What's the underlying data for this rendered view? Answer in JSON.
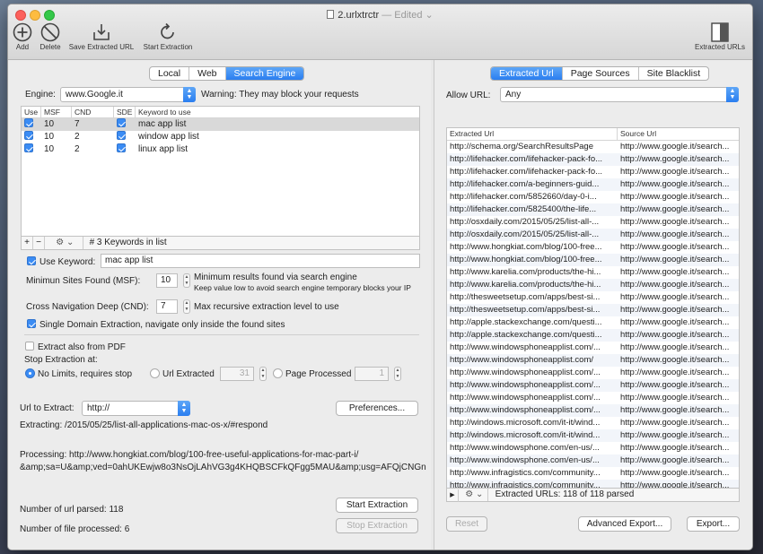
{
  "window": {
    "title": "2.urlxtrctr",
    "edited": "— Edited"
  },
  "toolbar": {
    "add": "Add",
    "delete": "Delete",
    "save": "Save Extracted URL",
    "start": "Start Extraction",
    "extracted_urls": "Extracted URLs"
  },
  "left": {
    "tabs": [
      "Local",
      "Web",
      "Search Engine"
    ],
    "active_tab": "Search Engine",
    "engine_label": "Engine:",
    "engine_value": "www.Google.it",
    "engine_warning": "Warning: They may block your requests",
    "keyword_table": {
      "headers": [
        "Use",
        "MSF",
        "CND",
        "SDE",
        "Keyword to use"
      ],
      "rows": [
        {
          "msf": "10",
          "cnd": "7",
          "keyword": "mac app list"
        },
        {
          "msf": "10",
          "cnd": "2",
          "keyword": "window app list"
        },
        {
          "msf": "10",
          "cnd": "2",
          "keyword": "linux app list"
        }
      ],
      "footer": "# 3 Keywords in list"
    },
    "use_keyword_label": "Use Keyword:",
    "use_keyword_value": "mac app list",
    "msf_label": "Minimun Sites Found (MSF):",
    "msf_value": "10",
    "msf_help": "Minimum results found via search engine",
    "msf_help2": "Keep value low to avoid search engine temporary blocks your IP",
    "cnd_label": "Cross Navigation Deep (CND):",
    "cnd_value": "7",
    "cnd_help": "Max recursive extraction level to use",
    "sde_label": "Single Domain Extraction, navigate only inside the found sites",
    "extract_pdf": "Extract also from PDF",
    "stop_label": "Stop Extraction at:",
    "stop_opt1": "No Limits, requires stop",
    "stop_opt2": "Url Extracted",
    "stop_opt2_value": "31",
    "stop_opt3": "Page Processed",
    "stop_opt3_value": "1",
    "url_label": "Url to Extract:",
    "url_value": "http://",
    "preferences": "Preferences...",
    "extracting": "Extracting: /2015/05/25/list-all-applications-mac-os-x/#respond",
    "processing1": "Processing: http://www.hongkiat.com/blog/100-free-useful-applications-for-mac-part-i/",
    "processing2": "&amp;sa=U&amp;ved=0ahUKEwjw8o3NsOjLAhVG3g4KHQBSCFkQFgg5MAU&amp;usg=AFQjCNGn",
    "parsed_label": "Number of url parsed: 118",
    "processed_label": "Number of file processed: 6",
    "start_btn": "Start Extraction",
    "stop_btn": "Stop Extraction"
  },
  "right": {
    "tabs": [
      "Extracted Url",
      "Page Sources",
      "Site Blacklist"
    ],
    "active_tab": "Extracted Url",
    "allow_label": "Allow URL:",
    "allow_value": "Any",
    "headers": [
      "Extracted Url",
      "Source Url"
    ],
    "rows": [
      [
        "http://schema.org/SearchResultsPage",
        "http://www.google.it/search..."
      ],
      [
        "http://lifehacker.com/lifehacker-pack-fo...",
        "http://www.google.it/search..."
      ],
      [
        "http://lifehacker.com/lifehacker-pack-fo...",
        "http://www.google.it/search..."
      ],
      [
        "http://lifehacker.com/a-beginners-guid...",
        "http://www.google.it/search..."
      ],
      [
        "http://lifehacker.com/5852660/day-0-i...",
        "http://www.google.it/search..."
      ],
      [
        "http://lifehacker.com/5825400/the-life...",
        "http://www.google.it/search..."
      ],
      [
        "http://osxdaily.com/2015/05/25/list-all-...",
        "http://www.google.it/search..."
      ],
      [
        "http://osxdaily.com/2015/05/25/list-all-...",
        "http://www.google.it/search..."
      ],
      [
        "http://www.hongkiat.com/blog/100-free...",
        "http://www.google.it/search..."
      ],
      [
        "http://www.hongkiat.com/blog/100-free...",
        "http://www.google.it/search..."
      ],
      [
        "http://www.karelia.com/products/the-hi...",
        "http://www.google.it/search..."
      ],
      [
        "http://www.karelia.com/products/the-hi...",
        "http://www.google.it/search..."
      ],
      [
        "http://thesweetsetup.com/apps/best-si...",
        "http://www.google.it/search..."
      ],
      [
        "http://thesweetsetup.com/apps/best-si...",
        "http://www.google.it/search..."
      ],
      [
        "http://apple.stackexchange.com/questi...",
        "http://www.google.it/search..."
      ],
      [
        "http://apple.stackexchange.com/questi...",
        "http://www.google.it/search..."
      ],
      [
        "http://www.windowsphoneapplist.com/...",
        "http://www.google.it/search..."
      ],
      [
        "http://www.windowsphoneapplist.com/",
        "http://www.google.it/search..."
      ],
      [
        "http://www.windowsphoneapplist.com/...",
        "http://www.google.it/search..."
      ],
      [
        "http://www.windowsphoneapplist.com/...",
        "http://www.google.it/search..."
      ],
      [
        "http://www.windowsphoneapplist.com/...",
        "http://www.google.it/search..."
      ],
      [
        "http://www.windowsphoneapplist.com/...",
        "http://www.google.it/search..."
      ],
      [
        "http://windows.microsoft.com/it-it/wind...",
        "http://www.google.it/search..."
      ],
      [
        "http://windows.microsoft.com/it-it/wind...",
        "http://www.google.it/search..."
      ],
      [
        "http://www.windowsphone.com/en-us/...",
        "http://www.google.it/search..."
      ],
      [
        "http://www.windowsphone.com/en-us/...",
        "http://www.google.it/search..."
      ],
      [
        "http://www.infragistics.com/community...",
        "http://www.google.it/search..."
      ],
      [
        "http://www.infragistics.com/community...",
        "http://www.google.it/search..."
      ]
    ],
    "footer": "Extracted URLs: 118 of  118 parsed",
    "reset": "Reset",
    "advanced_export": "Advanced Export...",
    "export": "Export..."
  }
}
